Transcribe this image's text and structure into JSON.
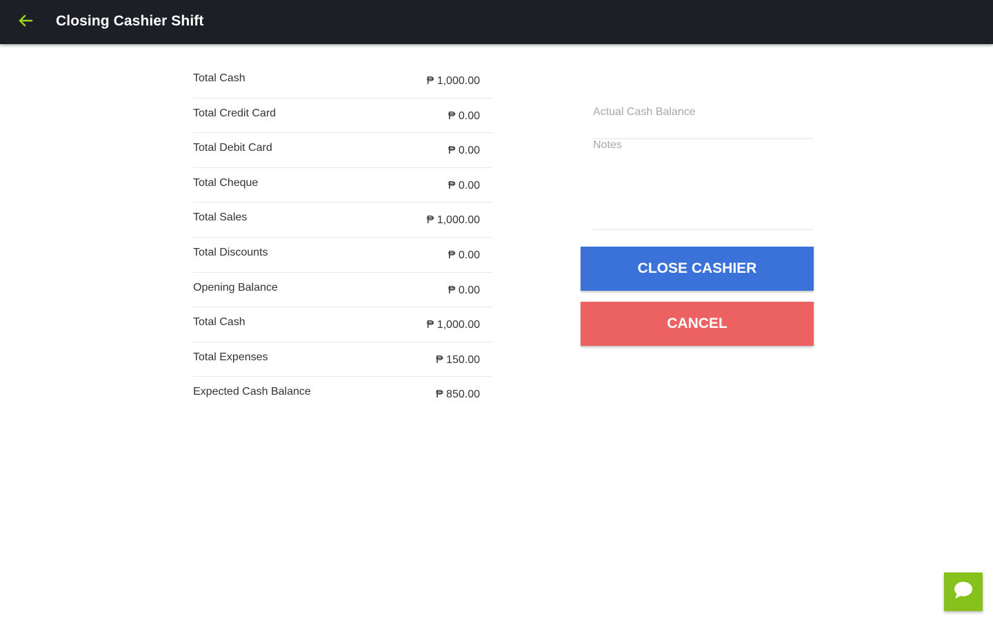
{
  "header": {
    "title": "Closing Cashier Shift",
    "back_icon": "arrow-left-icon",
    "accent_color": "#9bd11f",
    "background": "#1c1f26"
  },
  "summary": {
    "rows": [
      {
        "label": "Total Cash",
        "value": "₱ 1,000.00"
      },
      {
        "label": "Total Credit Card",
        "value": "₱ 0.00"
      },
      {
        "label": "Total Debit Card",
        "value": "₱ 0.00"
      },
      {
        "label": "Total Cheque",
        "value": "₱ 0.00"
      },
      {
        "label": "Total Sales",
        "value": "₱ 1,000.00"
      },
      {
        "label": "Total Discounts",
        "value": "₱ 0.00"
      },
      {
        "label": "Opening Balance",
        "value": "₱ 0.00"
      },
      {
        "label": "Total Cash",
        "value": "₱ 1,000.00"
      },
      {
        "label": "Total Expenses",
        "value": "₱ 150.00"
      },
      {
        "label": "Expected Cash Balance",
        "value": "₱ 850.00"
      }
    ]
  },
  "form": {
    "actual_cash": {
      "placeholder": "Actual Cash Balance",
      "value": ""
    },
    "notes": {
      "placeholder": "Notes",
      "value": ""
    }
  },
  "buttons": {
    "close_label": "CLOSE CASHIER",
    "close_color": "#3b72d9",
    "cancel_label": "CANCEL",
    "cancel_color": "#ec6262"
  },
  "chat": {
    "icon": "chat-bubble-icon",
    "color": "#86c11c"
  }
}
